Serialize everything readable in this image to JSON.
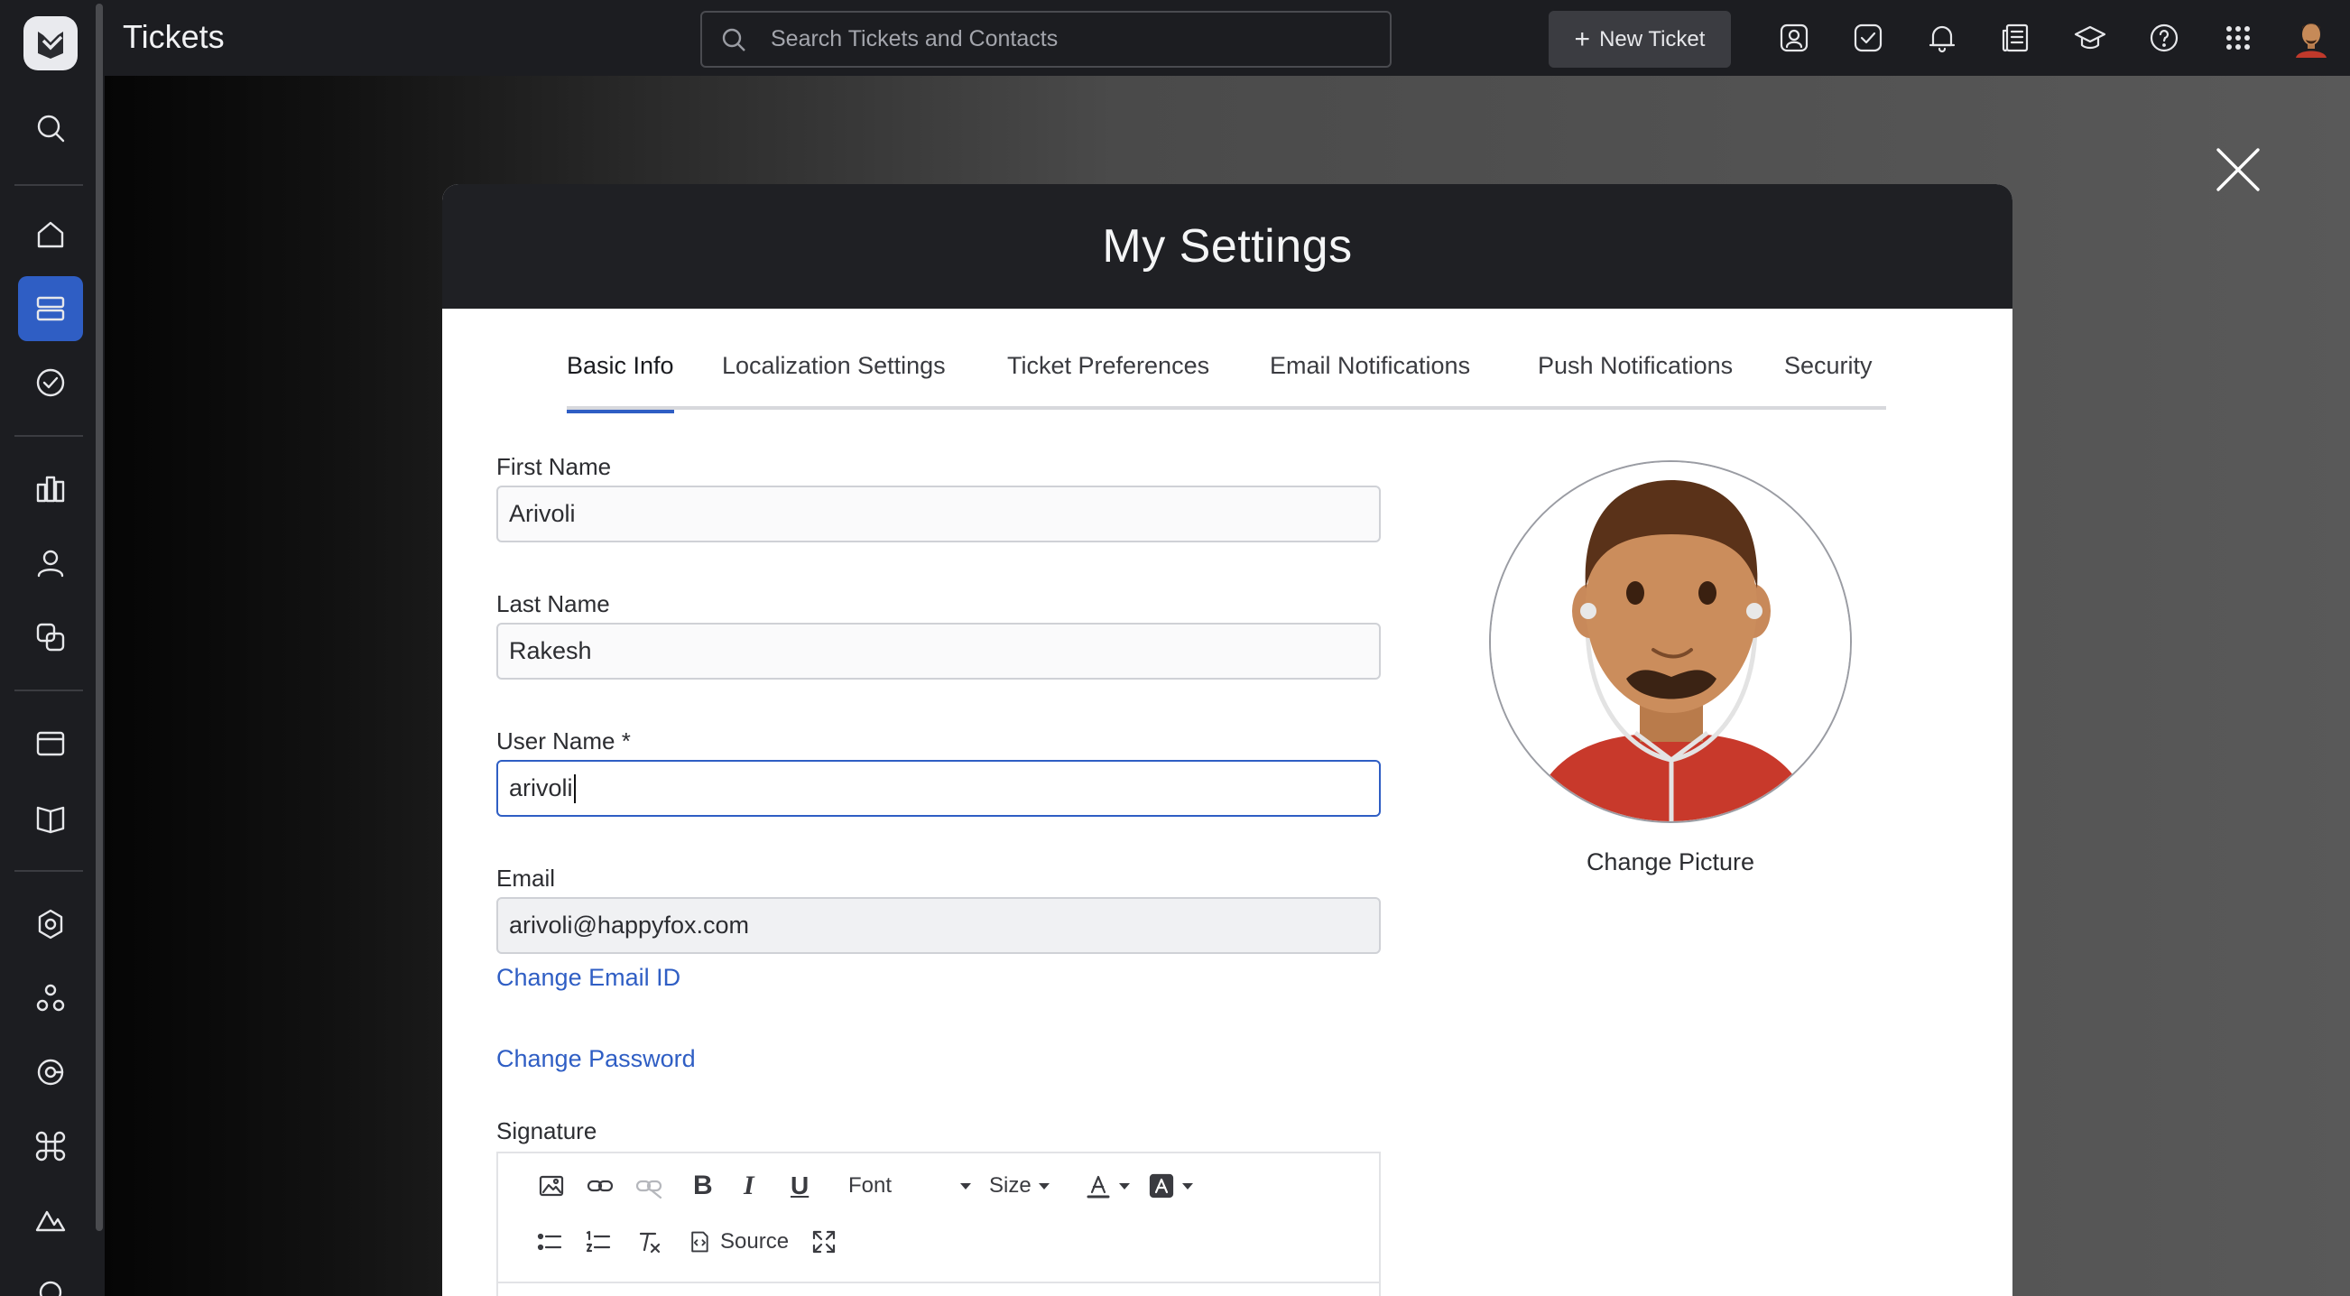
{
  "app": {
    "title": "Tickets"
  },
  "search": {
    "placeholder": "Search Tickets and Contacts"
  },
  "header": {
    "new_ticket_label": "New Ticket"
  },
  "modal": {
    "title": "My Settings",
    "tabs": [
      {
        "label": "Basic Info",
        "active": true
      },
      {
        "label": "Localization Settings"
      },
      {
        "label": "Ticket Preferences"
      },
      {
        "label": "Email Notifications"
      },
      {
        "label": "Push Notifications"
      },
      {
        "label": "Security"
      }
    ]
  },
  "form": {
    "first_name": {
      "label": "First Name",
      "value": "Arivoli"
    },
    "last_name": {
      "label": "Last Name",
      "value": "Rakesh"
    },
    "user_name": {
      "label": "User Name *",
      "value": "arivoli"
    },
    "email": {
      "label": "Email",
      "value": "arivoli@happyfox.com"
    },
    "change_email_label": "Change Email ID",
    "change_password_label": "Change Password",
    "signature_label": "Signature",
    "change_picture_label": "Change Picture"
  },
  "editor_toolbar": {
    "font_label": "Font",
    "size_label": "Size",
    "source_label": "Source"
  },
  "colors": {
    "accent": "#2f5ec4",
    "sidebar_bg": "#1c1d21",
    "avatar_shirt": "#c0392b"
  }
}
